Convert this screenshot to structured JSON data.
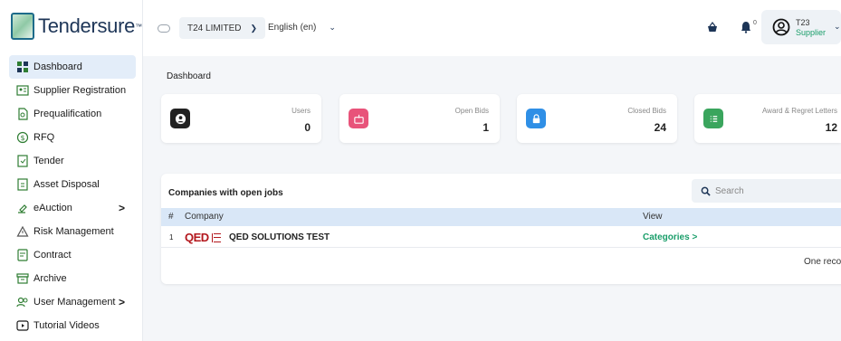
{
  "brand": {
    "name": "Tendersure",
    "tm": "™"
  },
  "sidebar": {
    "items": [
      {
        "label": "Dashboard",
        "icon": "dashboard-icon",
        "active": true
      },
      {
        "label": "Supplier Registration",
        "icon": "registration-icon"
      },
      {
        "label": "Prequalification",
        "icon": "prequalification-icon"
      },
      {
        "label": "RFQ",
        "icon": "rfq-icon"
      },
      {
        "label": "Tender",
        "icon": "tender-icon"
      },
      {
        "label": "Asset Disposal",
        "icon": "asset-disposal-icon"
      },
      {
        "label": "eAuction",
        "icon": "eauction-icon",
        "arrow": ">"
      },
      {
        "label": "Risk Management",
        "icon": "risk-icon"
      },
      {
        "label": "Contract",
        "icon": "contract-icon"
      },
      {
        "label": "Archive",
        "icon": "archive-icon"
      },
      {
        "label": "User Management",
        "icon": "user-management-icon",
        "arrow": ">"
      },
      {
        "label": "Tutorial Videos",
        "icon": "video-icon"
      }
    ]
  },
  "topbar": {
    "org": "T24 LIMITED",
    "language": "English (en)",
    "bell_count": "0",
    "user": {
      "name": "T23",
      "role": "Supplier"
    }
  },
  "main": {
    "breadcrumb": "Dashboard",
    "stats": [
      {
        "label": "Users",
        "value": "0",
        "icon": "user-icon",
        "color": "#222222"
      },
      {
        "label": "Open Bids",
        "value": "1",
        "icon": "open-bid-icon",
        "color": "#e8537a"
      },
      {
        "label": "Closed Bids",
        "value": "24",
        "icon": "lock-icon",
        "color": "#2f8fe6"
      },
      {
        "label": "Award & Regret Letters",
        "value": "12",
        "icon": "letters-icon",
        "color": "#3aa55d"
      }
    ],
    "companies": {
      "title": "Companies with open jobs",
      "search_placeholder": "Search",
      "columns": {
        "num": "#",
        "company": "Company",
        "view": "View"
      },
      "rows": [
        {
          "num": "1",
          "logo_text": "QED",
          "name": "QED SOLUTIONS TEST",
          "view_label": "Categories",
          "view_arrow": ">"
        }
      ],
      "footer": "One record"
    }
  }
}
